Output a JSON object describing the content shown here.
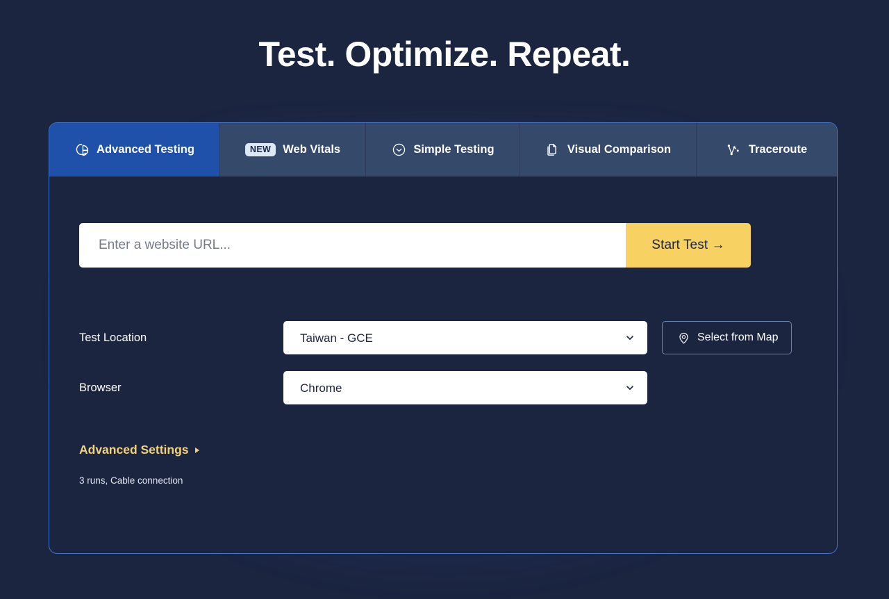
{
  "hero": {
    "title": "Test. Optimize. Repeat."
  },
  "colors": {
    "page_bg": "#1b2540",
    "card_border": "#3f74cf",
    "tab_active_bg": "#1f51ab",
    "tab_inactive_bg": "#35496b",
    "accent_yellow": "#f7d262",
    "advanced_link": "#f3d37a",
    "badge_bg": "#dde8f7"
  },
  "tabs": [
    {
      "id": "advanced-testing",
      "label": "Advanced Testing",
      "icon": "pie-chart-icon",
      "active": true,
      "badge": null
    },
    {
      "id": "web-vitals",
      "label": "Web Vitals",
      "icon": "new-badge",
      "active": false,
      "badge": "NEW"
    },
    {
      "id": "simple-testing",
      "label": "Simple Testing",
      "icon": "check-circle-icon",
      "active": false,
      "badge": null
    },
    {
      "id": "visual-comparison",
      "label": "Visual Comparison",
      "icon": "copy-pages-icon",
      "active": false,
      "badge": null
    },
    {
      "id": "traceroute",
      "label": "Traceroute",
      "icon": "network-route-icon",
      "active": false,
      "badge": null
    }
  ],
  "url_form": {
    "input_value": "",
    "input_placeholder": "Enter a website URL...",
    "submit_label": "Start Test →"
  },
  "fields": {
    "location": {
      "label": "Test Location",
      "selected": "Taiwan - GCE",
      "options": [
        "Taiwan - GCE"
      ],
      "map_button_label": "Select from Map",
      "map_button_icon": "map-pin-icon"
    },
    "browser": {
      "label": "Browser",
      "selected": "Chrome",
      "options": [
        "Chrome"
      ]
    }
  },
  "advanced": {
    "link_label": "Advanced Settings",
    "caret_icon": "chevron-right-icon",
    "summary": "3 runs, Cable connection"
  }
}
